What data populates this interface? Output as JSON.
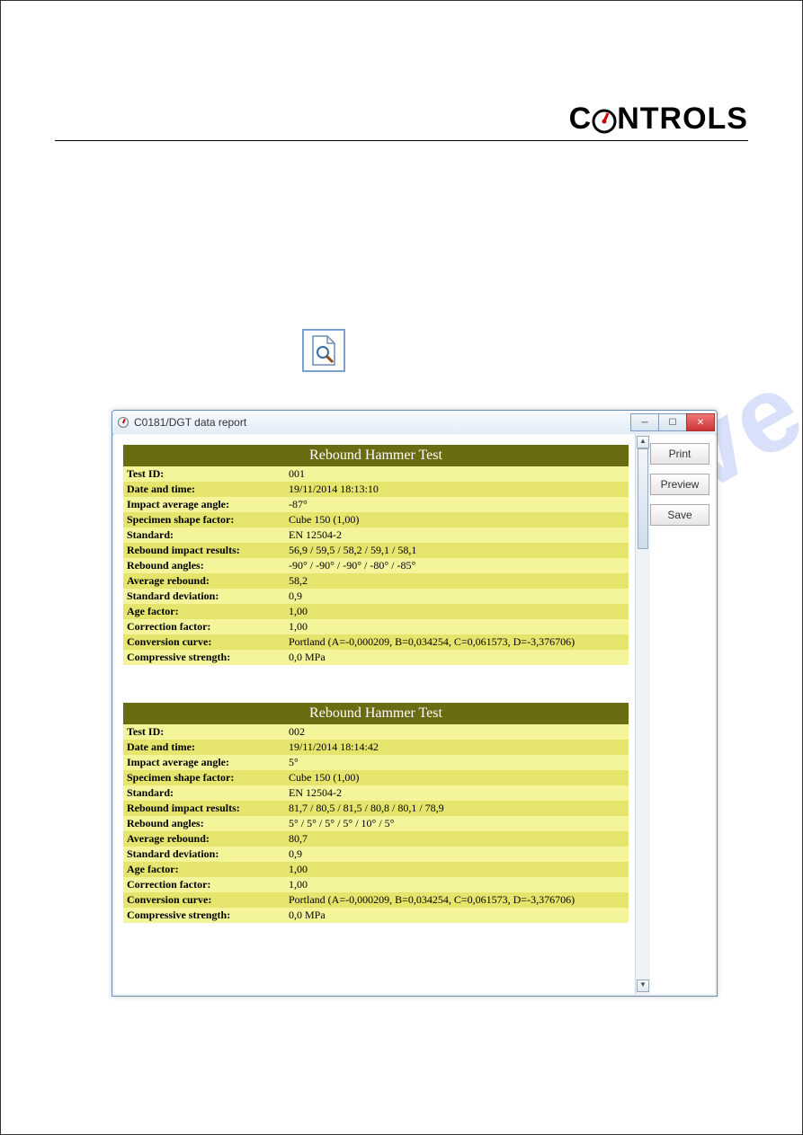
{
  "brand": {
    "left": "C",
    "right": "NTROLS"
  },
  "watermark": "manualslive.com",
  "window": {
    "title": "C0181/DGT data report"
  },
  "side_buttons": {
    "print": "Print",
    "preview": "Preview",
    "save": "Save"
  },
  "report_heading": "Rebound Hammer Test",
  "labels": {
    "test_id": "Test ID:",
    "date_time": "Date and time:",
    "impact_avg_angle": "Impact average angle:",
    "shape_factor": "Specimen shape factor:",
    "standard": "Standard:",
    "rebound_results": "Rebound impact results:",
    "rebound_angles": "Rebound angles:",
    "avg_rebound": "Average rebound:",
    "std_dev": "Standard deviation:",
    "age_factor": "Age factor:",
    "corr_factor": "Correction factor:",
    "conv_curve": "Conversion curve:",
    "comp_strength": "Compressive strength:"
  },
  "reports": [
    {
      "test_id": "001",
      "date_time": "19/11/2014 18:13:10",
      "impact_avg_angle": "-87°",
      "shape_factor": "Cube 150 (1,00)",
      "standard": "EN 12504-2",
      "rebound_results": "56,9 / 59,5 / 58,2 / 59,1 / 58,1",
      "rebound_angles": "-90° / -90° / -90° / -80° / -85°",
      "avg_rebound": "58,2",
      "std_dev": "0,9",
      "age_factor": "1,00",
      "corr_factor": "1,00",
      "conv_curve": "Portland (A=-0,000209, B=0,034254, C=0,061573, D=-3,376706)",
      "comp_strength": "0,0 MPa"
    },
    {
      "test_id": "002",
      "date_time": "19/11/2014 18:14:42",
      "impact_avg_angle": "5°",
      "shape_factor": "Cube 150 (1,00)",
      "standard": "EN 12504-2",
      "rebound_results": "81,7 / 80,5 / 81,5 / 80,8 / 80,1 / 78,9",
      "rebound_angles": "5° / 5° / 5° / 5° / 10° / 5°",
      "avg_rebound": "80,7",
      "std_dev": "0,9",
      "age_factor": "1,00",
      "corr_factor": "1,00",
      "conv_curve": "Portland (A=-0,000209, B=0,034254, C=0,061573, D=-3,376706)",
      "comp_strength": "0,0 MPa"
    }
  ]
}
